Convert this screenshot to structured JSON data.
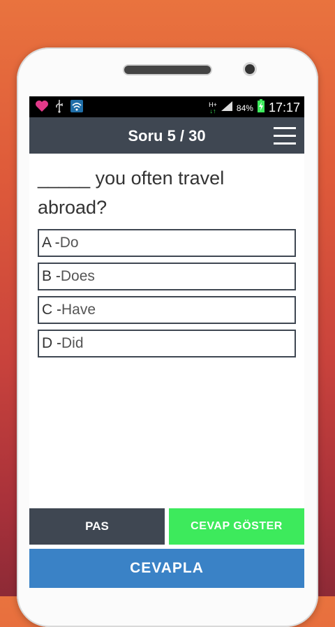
{
  "status_bar": {
    "icons_left": [
      "heart-icon",
      "usb-icon",
      "wifi-icon"
    ],
    "network_label": "H+",
    "battery_percent": "84%",
    "time": "17:17"
  },
  "app_bar": {
    "title": "Soru 5 / 30",
    "menu_icon": "hamburger-menu-icon"
  },
  "question": {
    "text": "_____ you often travel abroad?"
  },
  "options": [
    {
      "letter": "A - ",
      "text": "Do"
    },
    {
      "letter": "B - ",
      "text": "Does"
    },
    {
      "letter": "C - ",
      "text": "Have"
    },
    {
      "letter": "D - ",
      "text": "Did"
    }
  ],
  "buttons": {
    "pass": "PAS",
    "show_answer": "CEVAP GÖSTER",
    "answer": "CEVAPLA"
  },
  "colors": {
    "app_bar": "#3f4752",
    "show_answer": "#3dea5c",
    "answer": "#3a82c6",
    "heart": "#e23a8a"
  }
}
